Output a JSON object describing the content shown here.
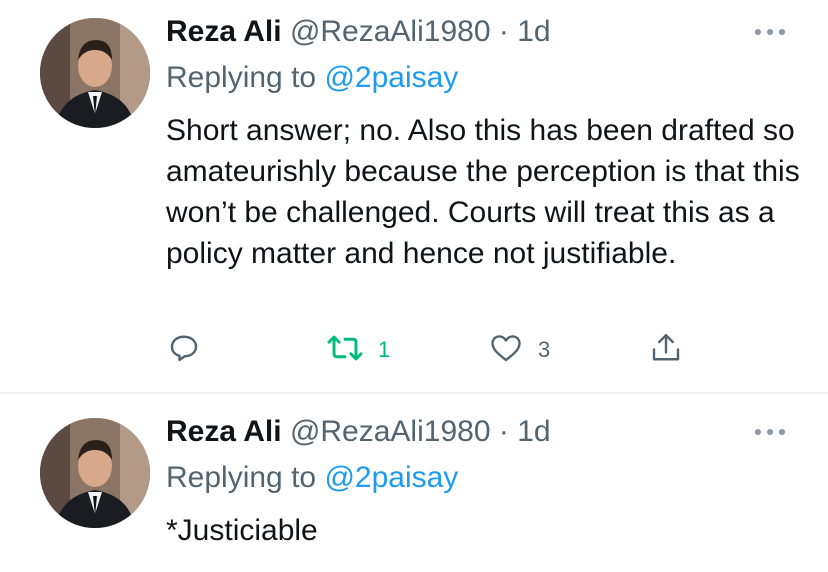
{
  "tweets": [
    {
      "author_name": "Reza Ali",
      "handle": "@RezaAli1980",
      "separator": "·",
      "time": "1d",
      "replying_prefix": "Replying to ",
      "replying_to": "@2paisay",
      "text": "Short answer; no. Also this has been drafted so amateurishly because the perception is that this won’t be challenged. Courts will  treat this as a policy matter and hence not justifiable.",
      "actions": {
        "reply_icon": "reply-icon",
        "retweet_icon": "retweet-icon",
        "retweet_count": "1",
        "like_icon": "heart-icon",
        "like_count": "3",
        "share_icon": "share-icon"
      }
    },
    {
      "author_name": "Reza Ali",
      "handle": "@RezaAli1980",
      "separator": "·",
      "time": "1d",
      "replying_prefix": "Replying to ",
      "replying_to": "@2paisay",
      "text": "*Justiciable"
    }
  ],
  "colors": {
    "link": "#1d9bf0",
    "muted": "#536471",
    "retweet_active": "#00ba7c",
    "text": "#0f1419",
    "divider": "#eff3f4"
  }
}
